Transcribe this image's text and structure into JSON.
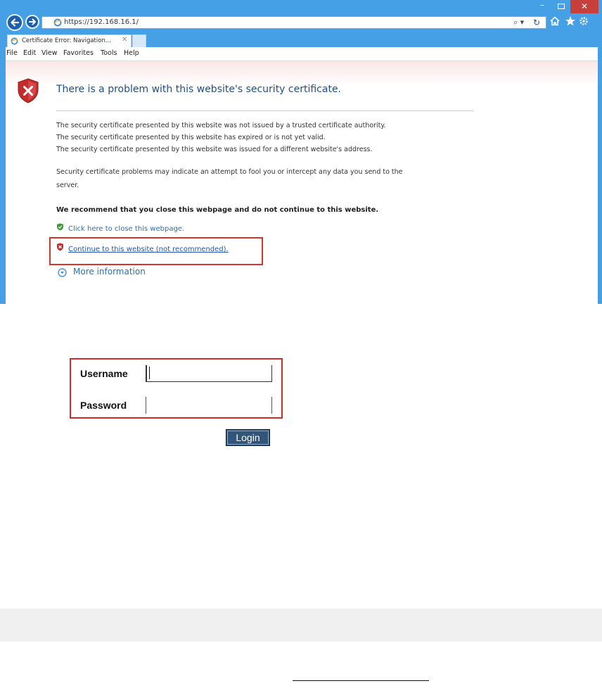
{
  "browser": {
    "address": "https://192.168.16.1/",
    "tab_title": "Certificate Error: Navigation...",
    "window_controls": {
      "minimize": "–",
      "close": "✕"
    },
    "icons": [
      "back-arrow-icon",
      "forward-arrow-icon",
      "search-icon",
      "refresh-icon",
      "home-icon",
      "favorites-star-icon",
      "settings-gear-icon"
    ]
  },
  "menu": [
    {
      "label": "File"
    },
    {
      "label": "Edit"
    },
    {
      "label": "View"
    },
    {
      "label": "Favorites"
    },
    {
      "label": "Tools"
    },
    {
      "label": "Help"
    }
  ],
  "error_page": {
    "headline": "There is a problem with this website's security certificate.",
    "reasons": [
      "The security certificate presented by this website was not issued by a trusted certificate authority.",
      "The security certificate presented by this website has expired or is not yet valid.",
      "The security certificate presented by this website was issued for a different website's address."
    ],
    "warning_lines": [
      "Security certificate problems may indicate an attempt to fool you or intercept any data you send to the",
      "server."
    ],
    "recommendation": "We recommend that you close this webpage and do not continue to this website.",
    "close_link": "Click here to close this webpage.",
    "continue_link": "Continue to this website (not recommended).",
    "more_info": "More information"
  },
  "login": {
    "username_label": "Username",
    "password_label": "Password",
    "username_value": "",
    "password_value": "",
    "button_label": "Login"
  },
  "colors": {
    "browser_frame": "#46a0e6",
    "close_button": "#c73f3b",
    "highlight_border": "#d9342b",
    "link": "#2a6fb8",
    "login_button": "#34557a"
  }
}
